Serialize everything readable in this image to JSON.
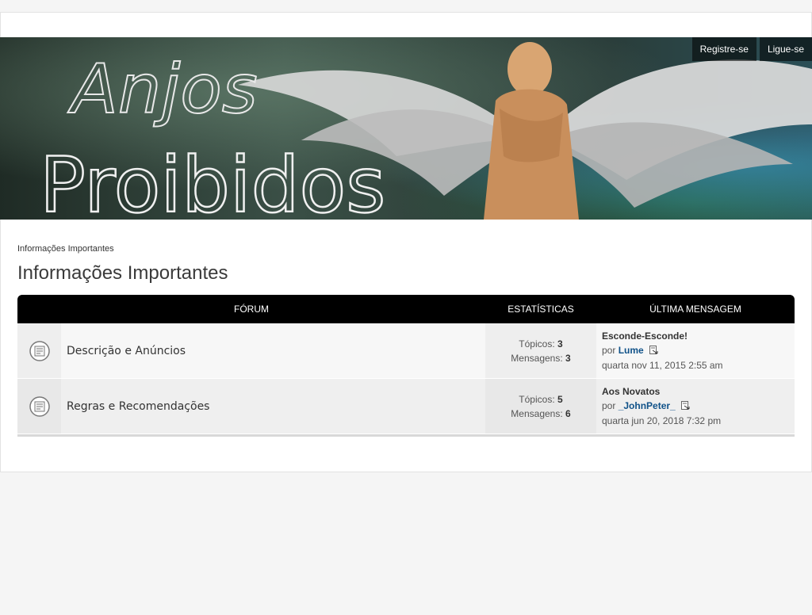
{
  "header": {
    "nav": [
      {
        "label": "Registre-se"
      },
      {
        "label": "Ligue-se"
      }
    ],
    "banner_logo_text": "Anjos Proibidos"
  },
  "breadcrumb": "Informações Importantes",
  "page_title": "Informações Importantes",
  "table": {
    "columns": [
      "FÓRUM",
      "ESTATÍSTICAS",
      "ÚLTIMA MENSAGEM"
    ],
    "rows": [
      {
        "name": "Descrição e Anúncios",
        "topics_label": "Tópicos:",
        "topics": "3",
        "posts_label": "Mensagens:",
        "posts": "3",
        "last_title": "Esconde-Esconde!",
        "by_label": "por",
        "last_user": "Lume",
        "last_date": "quarta nov 11, 2015 2:55 am"
      },
      {
        "name": "Regras e Recomendações",
        "topics_label": "Tópicos:",
        "topics": "5",
        "posts_label": "Mensagens:",
        "posts": "6",
        "last_title": "Aos Novatos",
        "by_label": "por",
        "last_user": "_JohnPeter_",
        "last_date": "quarta jun 20, 2018 7:32 pm"
      }
    ]
  },
  "colors": {
    "header_bg": "#000000",
    "username_link": "#105289",
    "page_bg": "#f5f5f5"
  },
  "icons": [
    "forum-read-icon",
    "view-latest-post-icon"
  ]
}
